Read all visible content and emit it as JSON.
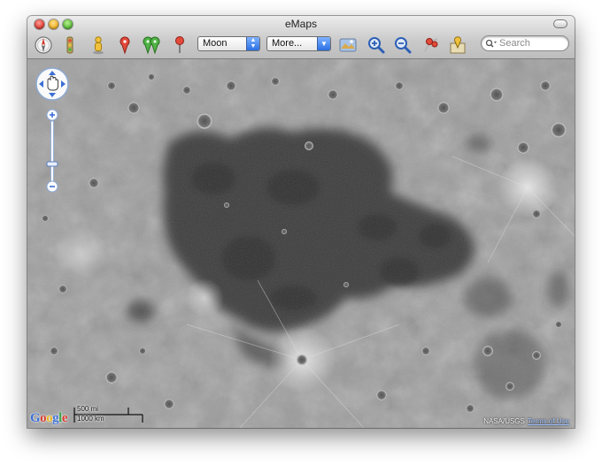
{
  "window": {
    "title": "eMaps"
  },
  "toolbar": {
    "icons": [
      "compass-icon",
      "traffic-light-icon",
      "person-icon",
      "pin-icon",
      "multi-pin-icon",
      "flag-pin-icon"
    ],
    "body_select": {
      "value": "Moon",
      "options": [
        "Moon"
      ]
    },
    "more_select": {
      "value": "More...",
      "options": [
        "More..."
      ]
    },
    "right_icons": [
      "layer-map-icon",
      "zoom-in-icon",
      "zoom-out-icon",
      "route-icon",
      "location-icon"
    ],
    "search": {
      "placeholder": "Search",
      "value": ""
    }
  },
  "map": {
    "attribution": "NASA/USGS",
    "terms_label": "Terms of Use",
    "logo_text": "Google",
    "logo_letters": [
      {
        "ch": "G",
        "color": "#3b6fd6"
      },
      {
        "ch": "o",
        "color": "#d93a2b"
      },
      {
        "ch": "o",
        "color": "#e8b41c"
      },
      {
        "ch": "g",
        "color": "#3b6fd6"
      },
      {
        "ch": "l",
        "color": "#36a045"
      },
      {
        "ch": "e",
        "color": "#d93a2b"
      }
    ],
    "scale": {
      "top_label": "500 mi",
      "bottom_label": "1000 km"
    }
  }
}
